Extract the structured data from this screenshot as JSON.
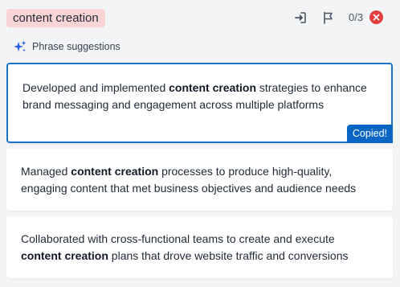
{
  "header": {
    "keyword": "content creation",
    "counter": "0/3"
  },
  "suggestions": {
    "label": "Phrase suggestions"
  },
  "cards": [
    {
      "before": "Developed and implemented ",
      "keyword": "content creation",
      "after": " strategies to enhance brand messaging and engagement across multiple platforms",
      "badge": "Copied!"
    },
    {
      "before": "Managed ",
      "keyword": "content creation",
      "after": " processes to produce high-quality, engaging content that met business objectives and audience needs"
    },
    {
      "before": "Collaborated with cross-functional teams to create and execute ",
      "keyword": "content creation",
      "after": " plans that drove website traffic and conversions"
    }
  ],
  "colors": {
    "accent": "#1a73c8",
    "badge_bg": "#0a66c2",
    "keyword_chip_bg": "#fbd5d5",
    "close_bg": "#e53e3e"
  },
  "icons": {
    "insert": "sign-in-icon",
    "flag": "flag-icon",
    "close": "close-icon",
    "sparkle": "sparkle-icon"
  }
}
